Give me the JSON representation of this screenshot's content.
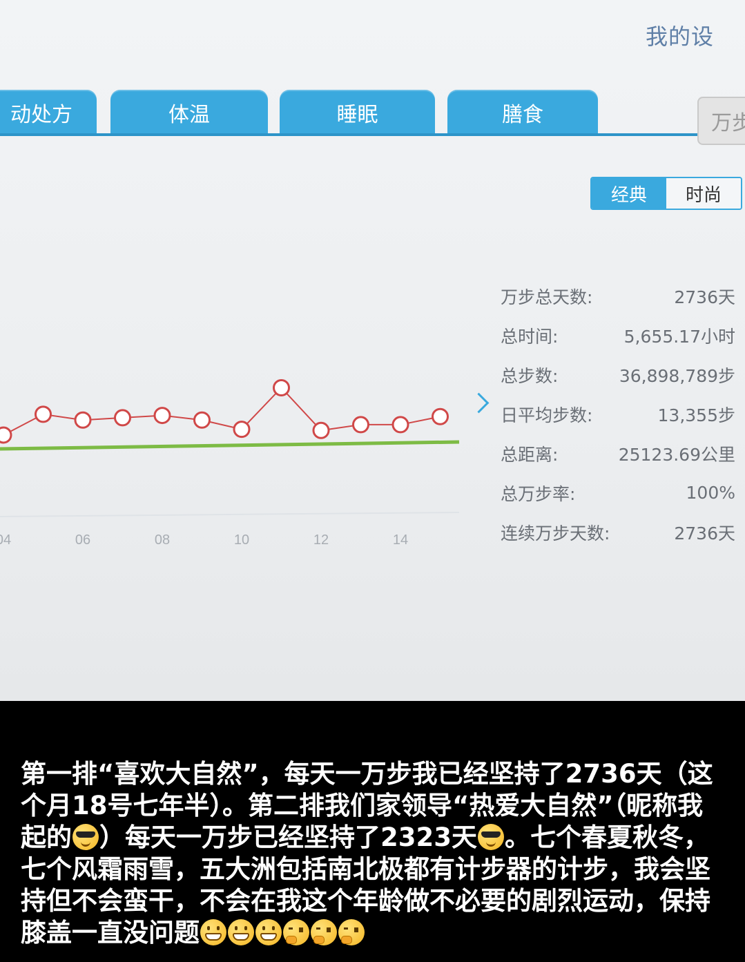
{
  "header": {
    "top_link": "我的设"
  },
  "tabs": [
    {
      "label": "动处方"
    },
    {
      "label": "体温"
    },
    {
      "label": "睡眠"
    },
    {
      "label": "膳食"
    }
  ],
  "side_card": {
    "label": "万步"
  },
  "toggle": {
    "options": [
      "经典",
      "时尚"
    ],
    "active": "经典"
  },
  "stats": [
    {
      "label": "万步总天数:",
      "value": "2736天"
    },
    {
      "label": "总时间:",
      "value": "5,655.17小时"
    },
    {
      "label": "总步数:",
      "value": "36,898,789步"
    },
    {
      "label": "日平均步数:",
      "value": "13,355步"
    },
    {
      "label": "总距离:",
      "value": "25123.69公里"
    },
    {
      "label": "总万步率:",
      "value": "100%"
    },
    {
      "label": "连续万步天数:",
      "value": "2736天"
    }
  ],
  "chart_data": {
    "type": "line",
    "x": [
      4,
      5,
      6,
      7,
      8,
      9,
      10,
      11,
      12,
      13,
      14,
      15
    ],
    "x_tick_labels": [
      "04",
      "06",
      "08",
      "10",
      "12",
      "14"
    ],
    "x_tick_values": [
      4,
      6,
      8,
      10,
      12,
      14
    ],
    "series": [
      {
        "values": [
          11200,
          13000,
          12500,
          12700,
          12900,
          12500,
          11700,
          15300,
          11600,
          12100,
          12100,
          12800
        ]
      }
    ],
    "target_line": 10000,
    "colors": {
      "line": "#d04848",
      "marker_fill": "#ffffff",
      "target": "#7dbb45"
    },
    "grid": false
  },
  "caption": {
    "parts": [
      {
        "t": "text",
        "v": "第一排“喜欢大自然”，每天一万步我已经坚持了2736天（这个月18号七年半）。第二排我们家领导“热爱大自然”（昵称我起的"
      },
      {
        "t": "emoji",
        "v": "cool"
      },
      {
        "t": "text",
        "v": "）每天一万步已经坚持了2323天"
      },
      {
        "t": "emoji",
        "v": "cool"
      },
      {
        "t": "text",
        "v": "。七个春夏秋冬，七个风霜雨雪，五大洲包括南北极都有计步器的计步，我会坚持但不会蛮干，不会在我这个年龄做不必要的剧烈运动，保持膝盖一直没问题"
      },
      {
        "t": "emoji",
        "v": "grin"
      },
      {
        "t": "emoji",
        "v": "grin"
      },
      {
        "t": "emoji",
        "v": "grin"
      },
      {
        "t": "emoji",
        "v": "think"
      },
      {
        "t": "emoji",
        "v": "think"
      },
      {
        "t": "emoji",
        "v": "think"
      }
    ]
  }
}
